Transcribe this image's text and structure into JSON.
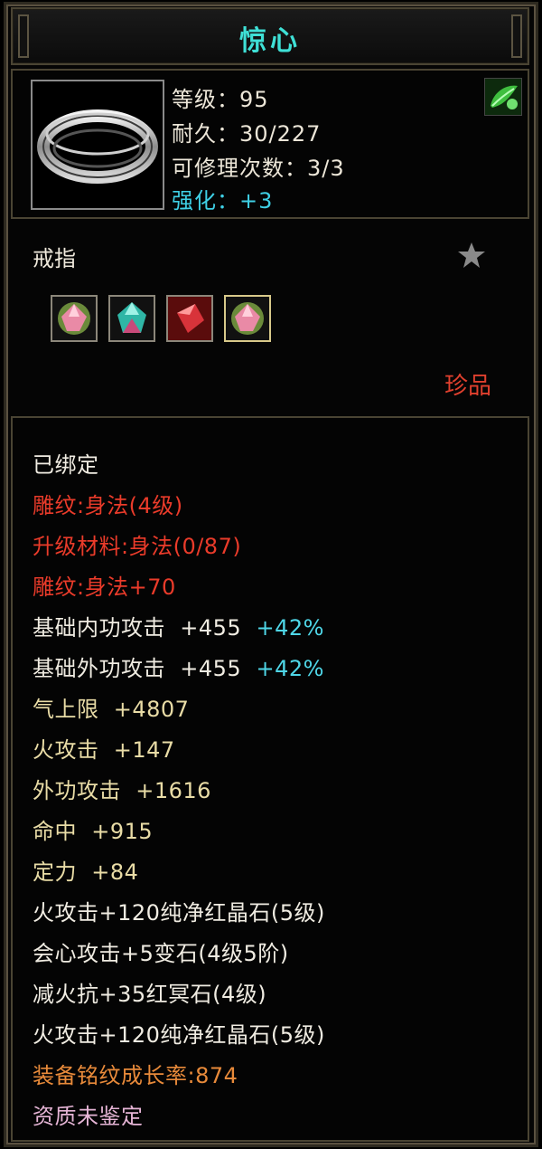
{
  "title": "惊心",
  "item": {
    "icon": "silver-ring-icon",
    "level_label": "等级：95",
    "durability_label": "耐久：30/227",
    "repair_label": "可修理次数：3/3",
    "enhance_label": "强化：+3",
    "badge_icon": "green-leaf-icon"
  },
  "type_label": "戒指",
  "favorite_icon": "star-icon",
  "gems": [
    {
      "icon": "pink-gem-icon"
    },
    {
      "icon": "cyan-gem-icon"
    },
    {
      "icon": "red-gem-icon"
    },
    {
      "icon": "pink-gem-icon"
    }
  ],
  "rarity": "珍品",
  "properties": [
    {
      "text": "已绑定",
      "color": "white"
    },
    {
      "text": "雕纹:身法(4级)",
      "color": "red"
    },
    {
      "text": "升级材料:身法(0/87)",
      "color": "red"
    },
    {
      "text": "雕纹:身法+70",
      "color": "red"
    },
    {
      "text": "基础内功攻击  +455",
      "extra": "+42%",
      "color": "white"
    },
    {
      "text": "基础外功攻击  +455",
      "extra": "+42%",
      "color": "white"
    },
    {
      "text": "气上限  +4807",
      "color": "yellow"
    },
    {
      "text": "火攻击  +147",
      "color": "yellow"
    },
    {
      "text": "外功攻击  +1616",
      "color": "yellow"
    },
    {
      "text": "命中  +915",
      "color": "yellow"
    },
    {
      "text": "定力  +84",
      "color": "yellow"
    },
    {
      "text": "火攻击+120纯净红晶石(5级)",
      "color": "white"
    },
    {
      "text": "会心攻击+5变石(4级5阶)",
      "color": "white"
    },
    {
      "text": "减火抗+35红冥石(4级)",
      "color": "white"
    },
    {
      "text": "火攻击+120纯净红晶石(5级)",
      "color": "white"
    },
    {
      "text": "装备铭纹成长率:874",
      "color": "orange"
    },
    {
      "text": "资质未鉴定",
      "color": "pink"
    }
  ]
}
